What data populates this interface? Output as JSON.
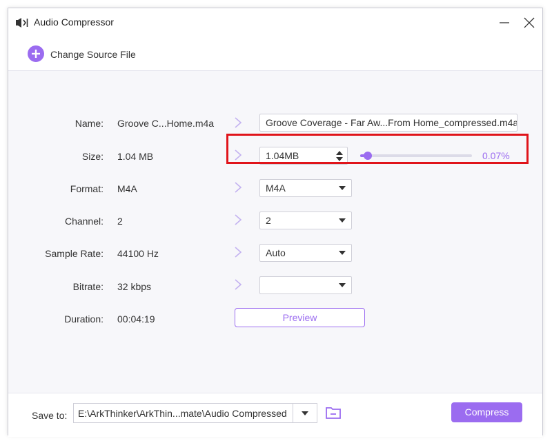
{
  "window": {
    "title": "Audio Compressor",
    "app_icon": "speaker-compress-icon",
    "controls": [
      "minimize-icon",
      "close-icon"
    ]
  },
  "source": {
    "icon": "plus-circle-icon",
    "label": "Change Source File"
  },
  "rows": {
    "name": {
      "label": "Name:",
      "value": "Groove C...Home.m4a",
      "output": "Groove Coverage - Far Aw...From Home_compressed.m4a"
    },
    "size": {
      "label": "Size:",
      "value": "1.04 MB",
      "output": "1.04MB",
      "percent_text": "0.07%",
      "slider_level": 0.07
    },
    "format": {
      "label": "Format:",
      "value": "M4A",
      "selected": "M4A"
    },
    "channel": {
      "label": "Channel:",
      "value": "2",
      "selected": "2"
    },
    "sample_rate": {
      "label": "Sample Rate:",
      "value": "44100 Hz",
      "selected": "Auto"
    },
    "bitrate": {
      "label": "Bitrate:",
      "value": "32 kbps",
      "selected": ""
    },
    "duration": {
      "label": "Duration:",
      "value": "00:04:19"
    }
  },
  "preview_label": "Preview",
  "bottom": {
    "save_label": "Save to:",
    "path": "E:\\ArkThinker\\ArkThin...mate\\Audio Compressed",
    "folder_icon": "folder-icon",
    "compress_label": "Compress"
  },
  "colors": {
    "accent": "#9b6cf0",
    "highlight": "#e0141a",
    "chevron": "#c3b2f0"
  }
}
